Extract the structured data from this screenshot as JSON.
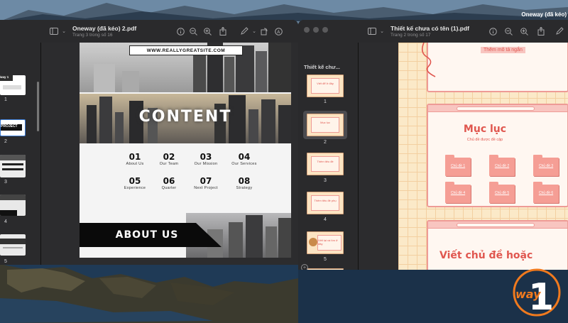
{
  "desktop": {
    "top_right_label": "Oneway (đã kéo)"
  },
  "window_left": {
    "title": "Oneway (đã kéo) 2.pdf",
    "subtitle": "Trang 3 trong số 16",
    "thumbnail_numbers": [
      "1",
      "2",
      "3",
      "4",
      "5"
    ],
    "thumbnail_labels": [
      "way 1",
      "PROJECT"
    ],
    "page": {
      "url": "WWW.REALLYGREATSITE.COM",
      "content_title": "CONTENT",
      "menu": [
        {
          "num": "01",
          "label": "About Us"
        },
        {
          "num": "02",
          "label": "Our Team"
        },
        {
          "num": "03",
          "label": "Our Mission"
        },
        {
          "num": "04",
          "label": "Our Services"
        },
        {
          "num": "05",
          "label": "Experience"
        },
        {
          "num": "06",
          "label": "Quarter"
        },
        {
          "num": "07",
          "label": "Next Project"
        },
        {
          "num": "08",
          "label": "Strategy"
        }
      ],
      "about_title": "ABOUT US"
    }
  },
  "window_right": {
    "title": "Thiết kế chưa có tên (1).pdf",
    "subtitle": "Trang 2 trong số 17",
    "sidebar_label": "Thiết kế chư...",
    "thumbnail_numbers": [
      "1",
      "2",
      "3",
      "4",
      "5"
    ],
    "thumbnail_texts": [
      "Viết để ở đây",
      "Mục lục",
      "Thêm tiêu đề",
      "Thêm tiêu đề phụ",
      "Viết lại và tìm ở đây"
    ],
    "page": {
      "top_label": "Thêm mô tả ngắn",
      "toc_title": "Mục lục",
      "toc_subtitle": "Chủ đề được đề cập",
      "folders": [
        "Chủ đề 1",
        "Chủ đề 2",
        "Chủ đề 3",
        "Chủ đề 4",
        "Chủ đề 5",
        "Chủ đề 6"
      ],
      "bottom_title": "Viết chủ đề hoặc"
    }
  },
  "logo": {
    "text": "way",
    "number": "1",
    "accent": "#f07a1e"
  },
  "colors": {
    "pink": "#ee9b96",
    "folder": "#f59e95",
    "red_text": "#e0574f",
    "grid_bg": "#fbe9c8"
  }
}
